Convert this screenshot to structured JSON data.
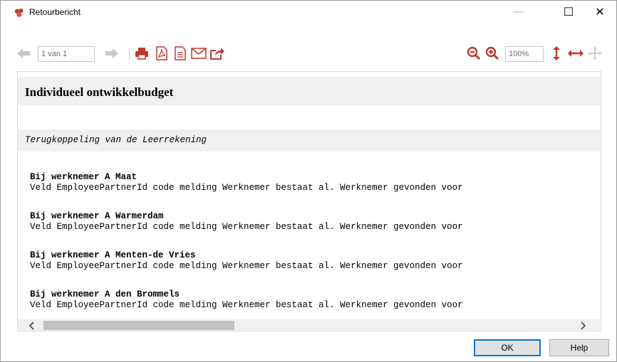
{
  "window": {
    "title": "Retourbericht",
    "controls": {
      "minimize": "—",
      "maximize": "☐",
      "close": "✕"
    }
  },
  "toolbar": {
    "page_value": "1 van 1",
    "zoom_value": "100%",
    "icons": [
      "arrow-left-icon",
      "arrow-right-icon",
      "print-icon",
      "pdf-icon",
      "document-icon",
      "email-icon",
      "share-icon",
      "zoom-out-icon",
      "zoom-in-icon",
      "fit-height-icon",
      "fit-width-icon",
      "move-icon"
    ],
    "accent_color": "#c0392b"
  },
  "document": {
    "heading": "Individueel ontwikkelbudget",
    "subheading": "Terugkoppeling van de Leerrekening",
    "entries": [
      {
        "employee": "Bij werknemer A Maat",
        "message": "Veld EmployeePartnerId code melding Werknemer bestaat al. Werknemer gevonden voor"
      },
      {
        "employee": "Bij werknemer A Warmerdam",
        "message": "Veld EmployeePartnerId code melding Werknemer bestaat al. Werknemer gevonden voor"
      },
      {
        "employee": "Bij werknemer A Menten-de Vries",
        "message": "Veld EmployeePartnerId code melding Werknemer bestaat al. Werknemer gevonden voor"
      },
      {
        "employee": "Bij werknemer A den Brommels",
        "message": "Veld EmployeePartnerId code melding Werknemer bestaat al. Werknemer gevonden voor"
      }
    ]
  },
  "buttons": {
    "ok": "OK",
    "help": "Help"
  }
}
